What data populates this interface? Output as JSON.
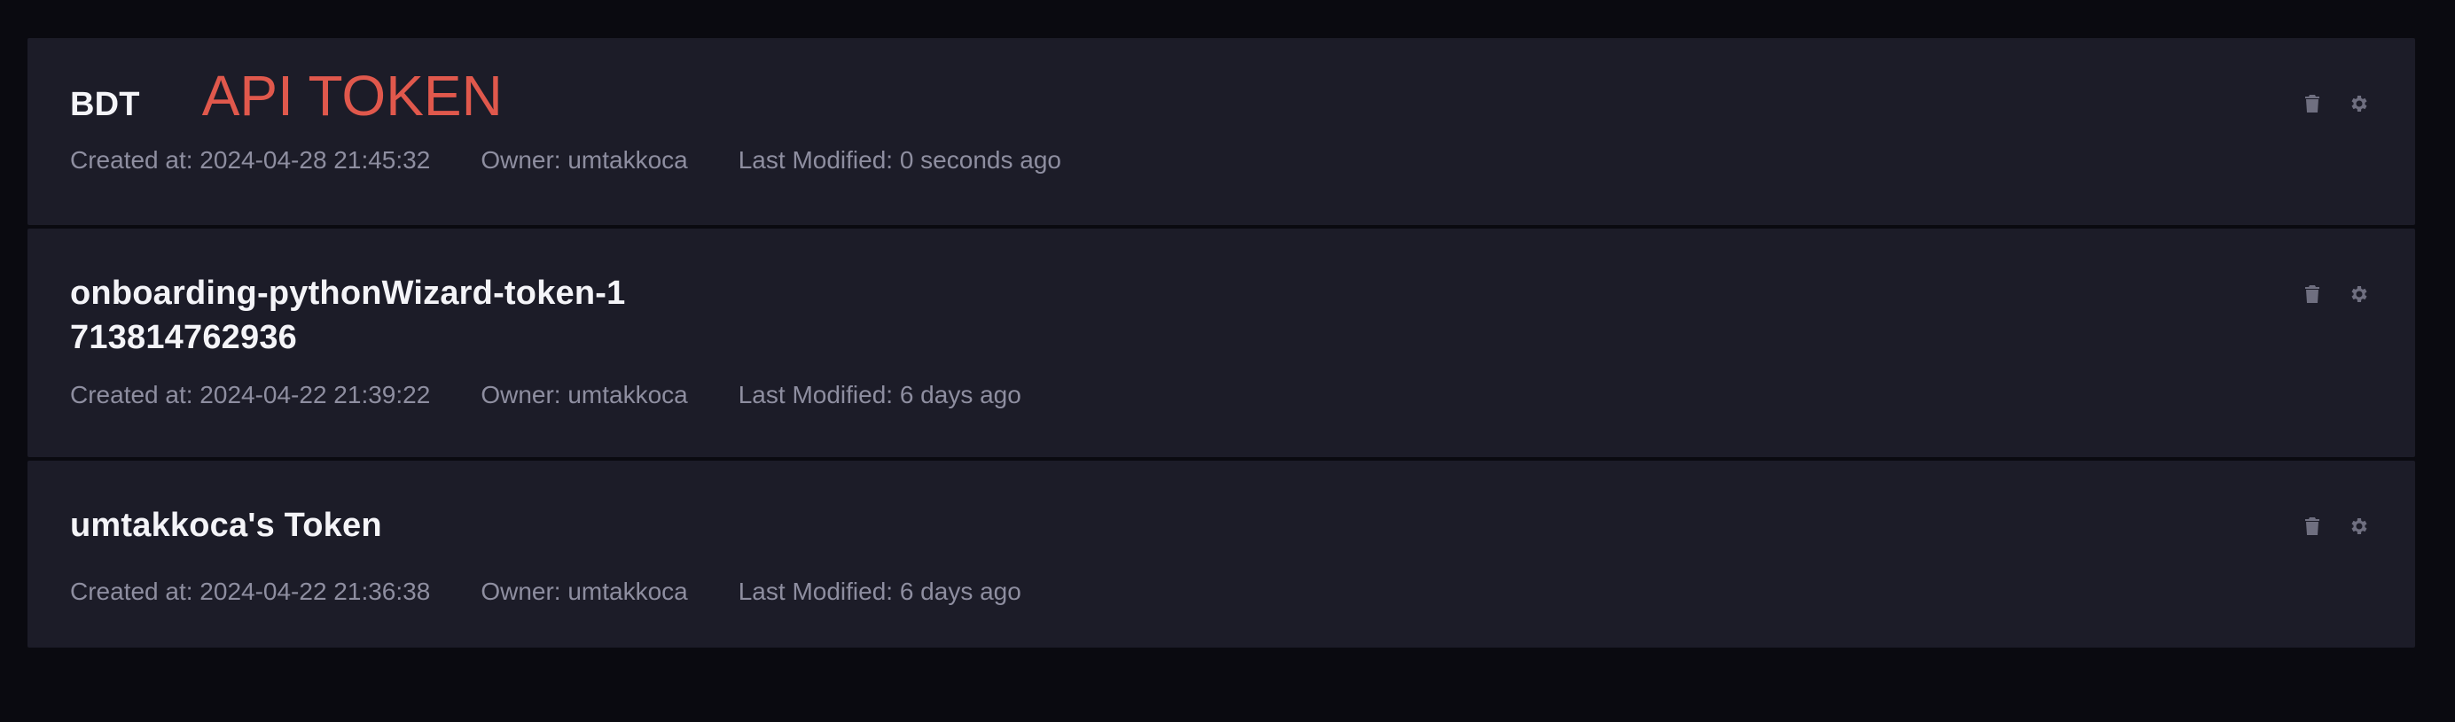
{
  "annotation": "API TOKEN",
  "colors": {
    "background": "#0a0a10",
    "card": "#1c1c28",
    "title": "#f4f4f8",
    "meta": "#8e8ea0",
    "icon": "#6f6f80",
    "annotation": "#e0584c"
  },
  "tokens": [
    {
      "title": "BDT",
      "created": "Created at: 2024-04-28 21:45:32",
      "owner": "Owner: umtakkoca",
      "modified": "Last Modified: 0 seconds ago",
      "icons": [
        "trash-icon",
        "gear-icon"
      ]
    },
    {
      "title": "onboarding-pythonWizard-token-1713814762936",
      "created": "Created at: 2024-04-22 21:39:22",
      "owner": "Owner: umtakkoca",
      "modified": "Last Modified: 6 days ago",
      "icons": [
        "trash-icon",
        "gear-icon"
      ]
    },
    {
      "title": "umtakkoca's Token",
      "created": "Created at: 2024-04-22 21:36:38",
      "owner": "Owner: umtakkoca",
      "modified": "Last Modified: 6 days ago",
      "icons": [
        "trash-icon",
        "gear-icon"
      ]
    }
  ]
}
